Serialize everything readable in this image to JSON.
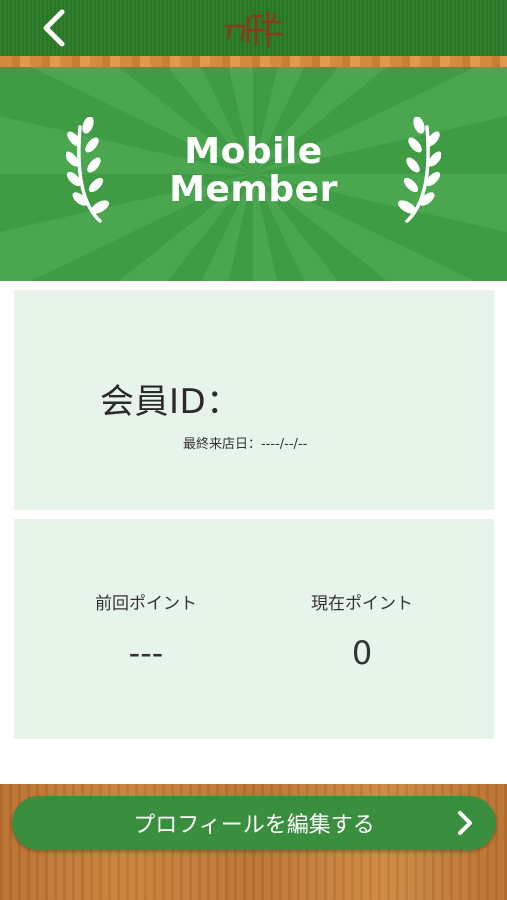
{
  "header": {
    "back_icon": "chevron-left-icon",
    "logo_icon": "store-logo-icon"
  },
  "banner": {
    "title_line1": "Mobile",
    "title_line2": "Member"
  },
  "member": {
    "id_label": "会員ID：",
    "last_visit": "最終来店日：----/--/--"
  },
  "points": {
    "previous_label": "前回ポイント",
    "previous_value": "---",
    "current_label": "現在ポイント",
    "current_value": "0"
  },
  "footer": {
    "edit_profile_label": "プロフィールを編集する"
  },
  "colors": {
    "header_green": "#2f7f2c",
    "banner_green": "#3f9b44",
    "card_bg": "#e6f4ea",
    "button_green": "#3a8f3f"
  }
}
